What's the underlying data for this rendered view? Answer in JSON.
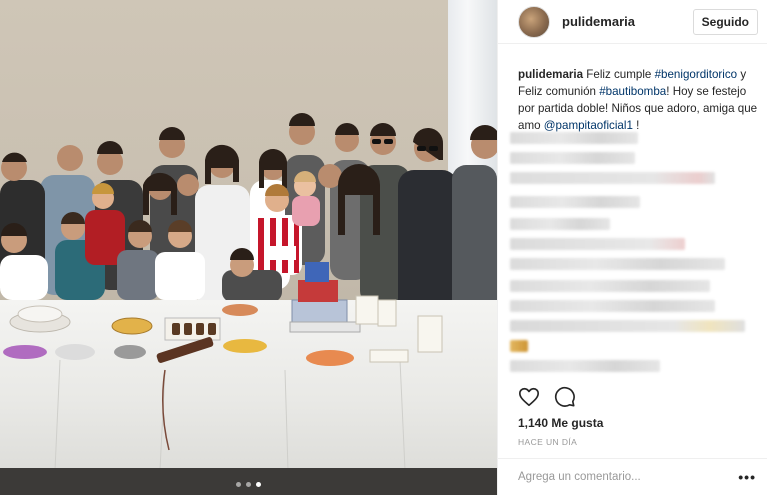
{
  "post": {
    "photo_alt": "Group photo of family and friends around a birthday table",
    "carousel": {
      "count": 3,
      "active": 2
    }
  },
  "header": {
    "username": "pulidemaria",
    "follow_label": "Seguido"
  },
  "caption": {
    "username": "pulidemaria",
    "t1": " Feliz cumple ",
    "tag1": "#benigorditorico",
    "t2": " y Feliz comunión ",
    "tag2": "#bautibomba",
    "t3": "! Hoy se festejo por partida doble! Niños que adoro, amiga que amo ",
    "tag3": "@pampitaoficial1",
    "t4": " !"
  },
  "stats": {
    "likes": "1,140 Me gusta",
    "time": "HACE UN DÍA"
  },
  "comment": {
    "placeholder": "Agrega un comentario...",
    "more": "•••"
  },
  "colors": {
    "link": "#003569",
    "muted": "#999999",
    "text": "#262626"
  },
  "icons": [
    "heart-icon",
    "comment-icon",
    "more-options-icon"
  ]
}
